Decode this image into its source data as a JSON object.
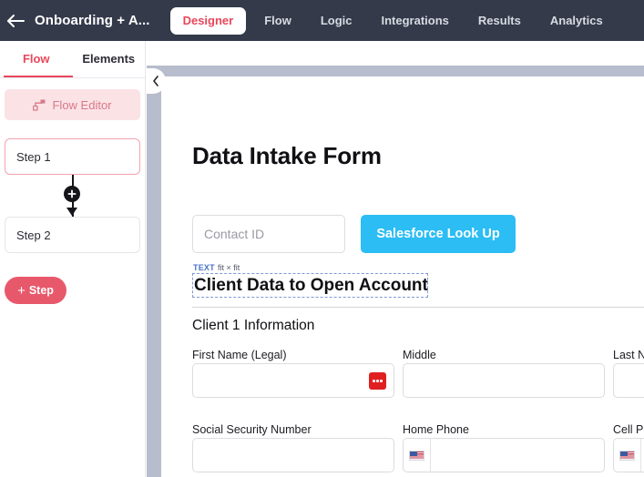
{
  "topbar": {
    "back_icon": "back-arrow-icon",
    "title": "Onboarding + A...",
    "nav": [
      {
        "label": "Designer",
        "active": true
      },
      {
        "label": "Flow",
        "active": false
      },
      {
        "label": "Logic",
        "active": false
      },
      {
        "label": "Integrations",
        "active": false
      },
      {
        "label": "Results",
        "active": false
      },
      {
        "label": "Analytics",
        "active": false
      }
    ],
    "accent": "#e8475a",
    "background": "#343a4a"
  },
  "left_panel": {
    "tabs": [
      {
        "label": "Flow",
        "active": true
      },
      {
        "label": "Elements",
        "active": false
      }
    ],
    "flow_editor": {
      "label": "Flow Editor",
      "icon": "flow-editor-icon"
    },
    "steps": [
      {
        "label": "Step 1",
        "selected": true
      },
      {
        "label": "Step 2",
        "selected": false
      }
    ],
    "connector_icon": "plus-circle-icon",
    "add_step": {
      "plus": "+",
      "label": "Step"
    }
  },
  "gutter": {
    "collapse_icon": "chevron-left-icon",
    "color": "#b7bdcc"
  },
  "canvas": {
    "form_title": "Data Intake Form",
    "contact_id": {
      "value": "",
      "placeholder": "Contact ID"
    },
    "salesforce_button": {
      "label": "Salesforce Look Up",
      "color": "#2bbdf4"
    },
    "selection_badge": {
      "type": "TEXT",
      "dims": "fit × fit",
      "color": "#4a73c8"
    },
    "selected_text": "Client Data to Open Account",
    "section_title": "Client 1 Information",
    "fields": [
      {
        "label": "First Name (Legal)",
        "value": "",
        "icon": "red-dots-icon"
      },
      {
        "label": "Middle",
        "value": ""
      },
      {
        "label": "Last N",
        "value": ""
      },
      {
        "label": "Social Security Number",
        "value": ""
      },
      {
        "label": "Home Phone",
        "value": "",
        "prefix_icon": "us-flag-icon"
      },
      {
        "label": "Cell Ph",
        "value": "",
        "prefix_icon": "us-flag-icon"
      }
    ]
  }
}
